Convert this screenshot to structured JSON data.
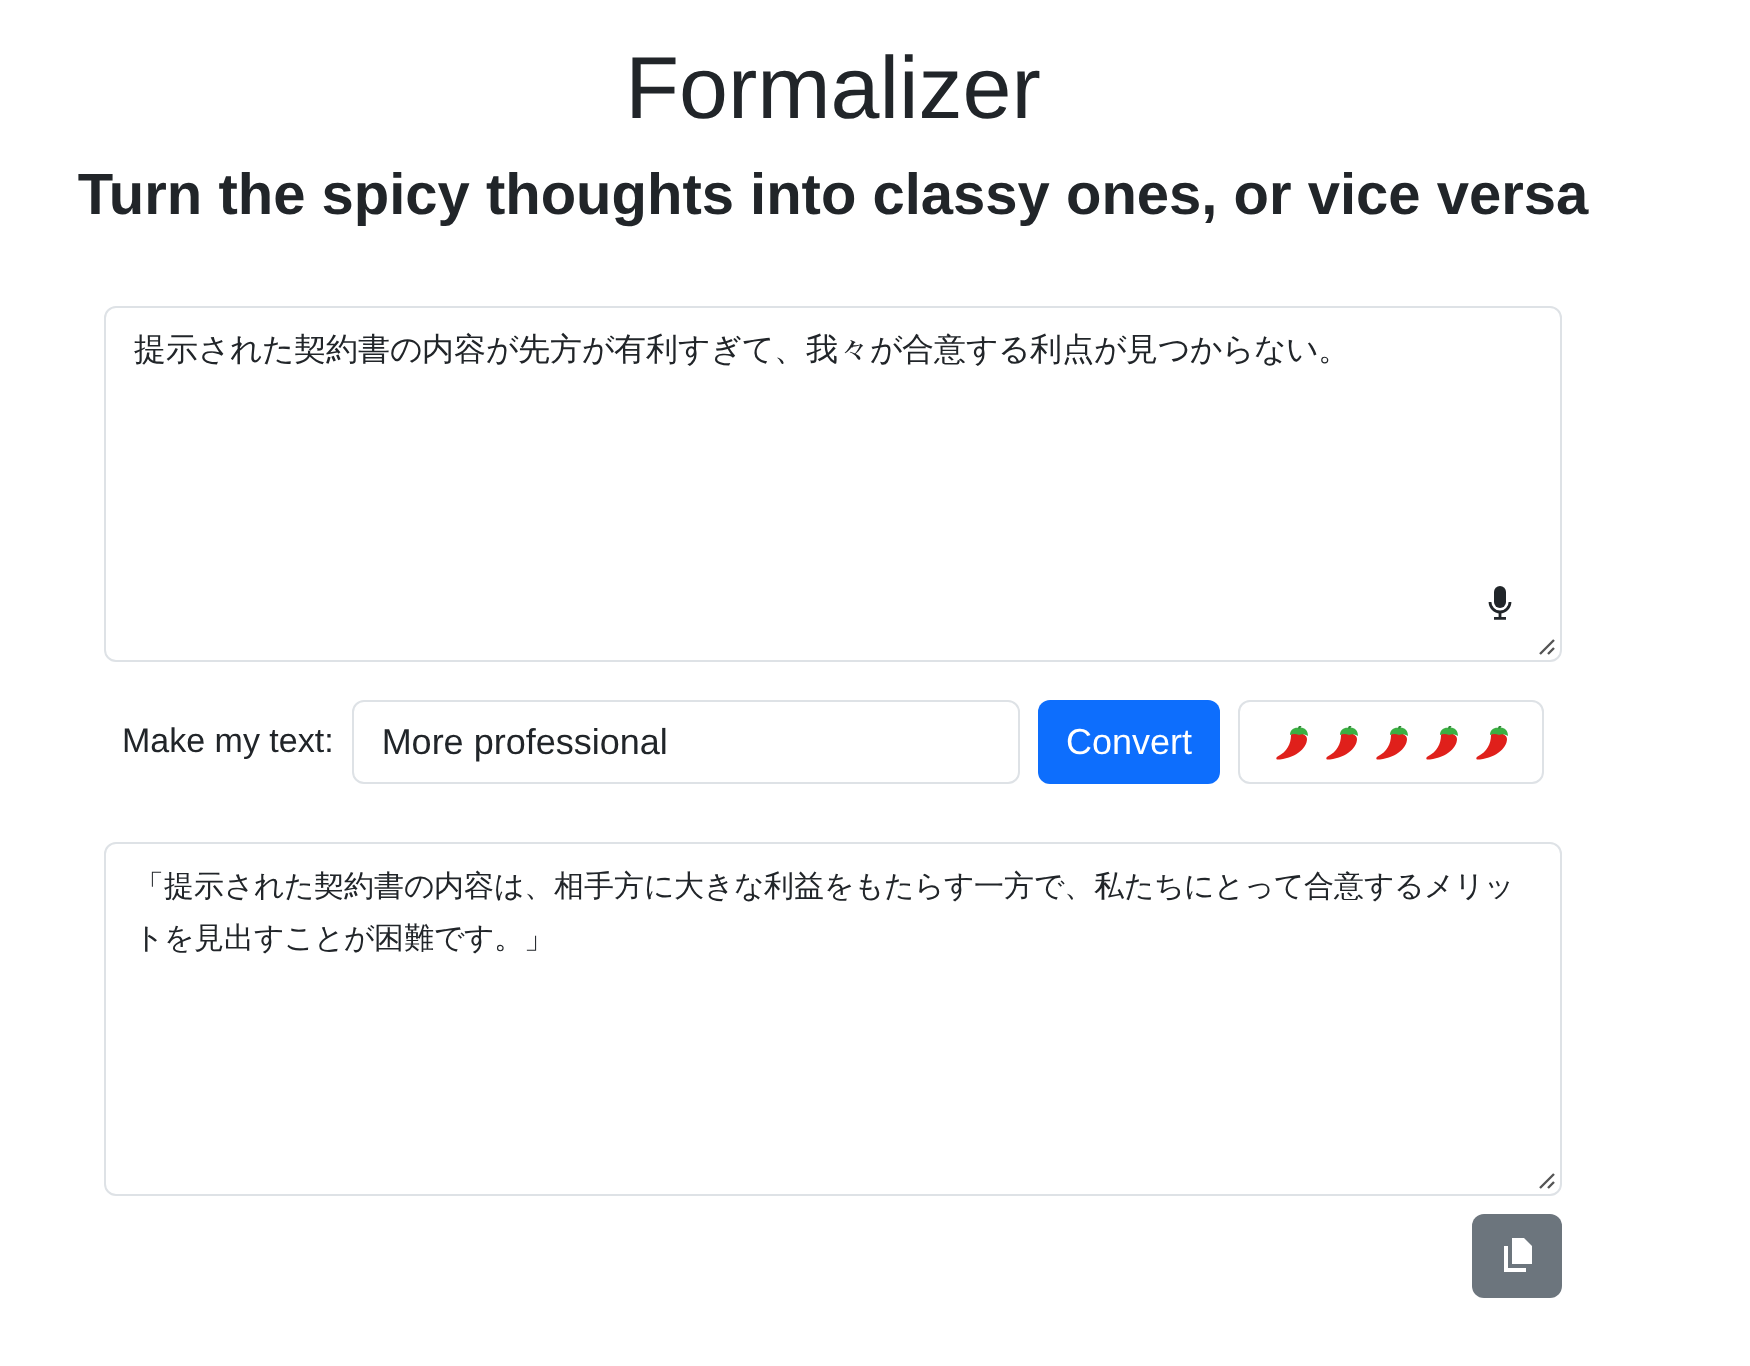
{
  "header": {
    "title": "Formalizer",
    "subtitle": "Turn the spicy thoughts into classy ones, or vice versa"
  },
  "source": {
    "value": "提示された契約書の内容が先方が有利すぎて、我々が合意する利点が見つからない。"
  },
  "controls": {
    "label": "Make my text:",
    "mode": "More professional",
    "convert_button": "Convert"
  },
  "result": {
    "value": "「提示された契約書の内容は、相手方に大きな利益をもたらす一方で、私たちにとって合意するメリットを見出すことが困難です。」"
  }
}
